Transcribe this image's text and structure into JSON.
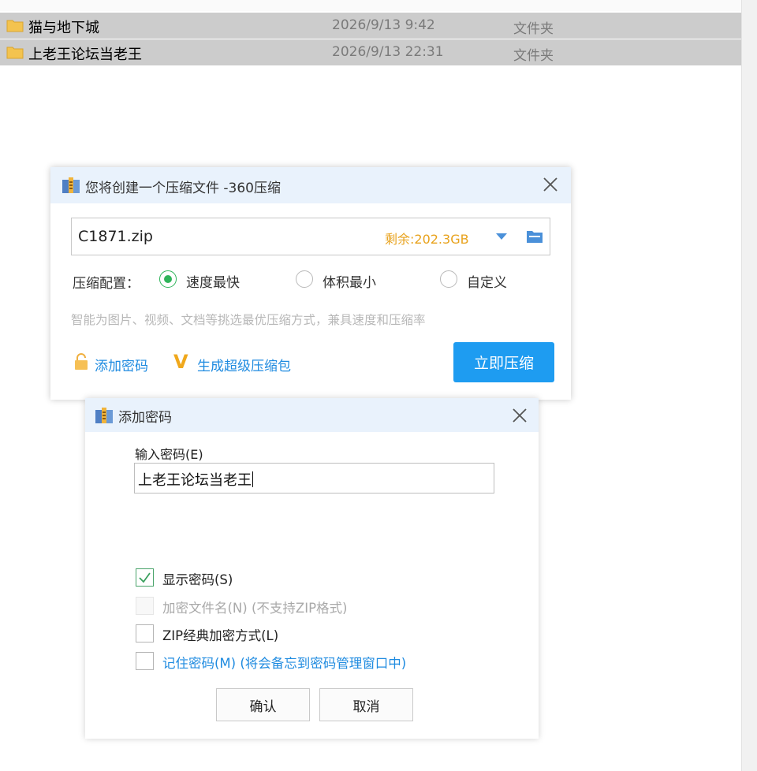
{
  "explorer": {
    "rows": [
      {
        "name": "猫与地下城",
        "date": "2026/9/13 9:42",
        "type": "文件夹",
        "icon": "folder-icon"
      },
      {
        "name": "上老王论坛当老王",
        "date": "2026/9/13 22:31",
        "type": "文件夹",
        "icon": "folder-icon"
      }
    ]
  },
  "compress_dialog": {
    "title": "您将创建一个压缩文件 -360压缩",
    "filename": "C1871.zip",
    "free_space": "剩余:202.3GB",
    "config_label": "压缩配置：",
    "options": [
      {
        "label": "速度最快",
        "selected": true
      },
      {
        "label": "体积最小",
        "selected": false
      },
      {
        "label": "自定义",
        "selected": false
      }
    ],
    "hint": "智能为图片、视频、文档等挑选最优压缩方式，兼具速度和压缩率",
    "add_password_link": "添加密码",
    "super_package_mark": "V",
    "super_package_link": "生成超级压缩包",
    "compress_button": "立即压缩",
    "accent_color": "#1e9cf1"
  },
  "password_dialog": {
    "title": "添加密码",
    "input_label": "输入密码(E)",
    "input_value": "上老王论坛当老王",
    "checkboxes": [
      {
        "label": "显示密码(S)",
        "checked": true,
        "disabled": false
      },
      {
        "label": "加密文件名(N) (不支持ZIP格式)",
        "checked": false,
        "disabled": true
      },
      {
        "label": "ZIP经典加密方式(L)",
        "checked": false,
        "disabled": false
      },
      {
        "label": "记住密码(M) (将会备忘到密码管理窗口中)",
        "checked": false,
        "disabled": false
      }
    ],
    "ok_button": "确认",
    "cancel_button": "取消"
  }
}
